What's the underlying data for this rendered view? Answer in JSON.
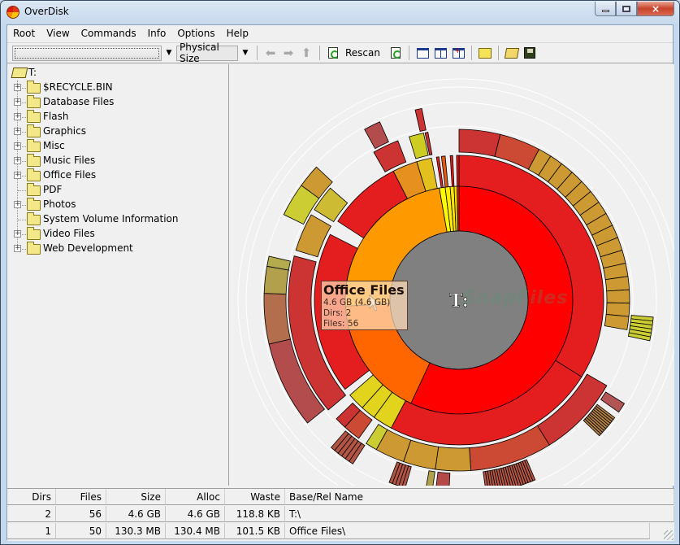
{
  "window": {
    "title": "OverDisk",
    "controls": {
      "minimize": "minimize",
      "maximize": "maximize",
      "close": "×"
    }
  },
  "menu": [
    "Root",
    "View",
    "Commands",
    "Info",
    "Options",
    "Help"
  ],
  "toolbar": {
    "path_value": "",
    "size_mode": "Physical Size",
    "rescan_label": "Rescan"
  },
  "tree": {
    "root": "T:",
    "items": [
      {
        "label": "$RECYCLE.BIN",
        "expandable": true
      },
      {
        "label": "Database Files",
        "expandable": true
      },
      {
        "label": "Flash",
        "expandable": true
      },
      {
        "label": "Graphics",
        "expandable": true
      },
      {
        "label": "Misc",
        "expandable": true
      },
      {
        "label": "Music Files",
        "expandable": true
      },
      {
        "label": "Office Files",
        "expandable": true
      },
      {
        "label": "PDF",
        "expandable": false
      },
      {
        "label": "Photos",
        "expandable": true
      },
      {
        "label": "System Volume Information",
        "expandable": false
      },
      {
        "label": "Video Files",
        "expandable": true
      },
      {
        "label": "Web Development",
        "expandable": true
      }
    ]
  },
  "chart": {
    "center_label": "T:",
    "watermark": "SnapFiles",
    "tooltip": {
      "title": "Office Files",
      "size": "4.6 GB (4.6 GB)",
      "dirs": "Dirs: 2",
      "files": "Files: 56"
    }
  },
  "chart_data": {
    "type": "sunburst",
    "title": "T:",
    "center_color": "#808080",
    "rings": [
      {
        "level": 1,
        "segments": [
          {
            "start": 0,
            "end": 205,
            "color": "#ff0000"
          },
          {
            "start": 205,
            "end": 267,
            "color": "#ff6600"
          },
          {
            "start": 267,
            "end": 350,
            "color": "#ff9900"
          },
          {
            "start": 350,
            "end": 353,
            "color": "#ffff00"
          },
          {
            "start": 353,
            "end": 355.5,
            "color": "#ffee00"
          },
          {
            "start": 355.5,
            "end": 357.5,
            "color": "#ffe400"
          },
          {
            "start": 357.5,
            "end": 359,
            "color": "#f0e000"
          },
          {
            "start": 359,
            "end": 360,
            "color": "#ff2a00"
          }
        ]
      },
      {
        "level": 2,
        "segments": [
          {
            "start": 0,
            "end": 122,
            "color": "#e41e1e"
          },
          {
            "start": 122,
            "end": 208,
            "color": "#e41e1e"
          },
          {
            "start": 208,
            "end": 216,
            "color": "#e2d31c"
          },
          {
            "start": 216,
            "end": 222,
            "color": "#e2d31c"
          },
          {
            "start": 222,
            "end": 229,
            "color": "#e2d31c"
          },
          {
            "start": 232,
            "end": 297,
            "color": "#e41e1e"
          },
          {
            "start": 303,
            "end": 333,
            "color": "#e41e1e"
          },
          {
            "start": 333,
            "end": 343,
            "color": "#e69020"
          },
          {
            "start": 343,
            "end": 349,
            "color": "#e4c01e"
          },
          {
            "start": 351,
            "end": 352,
            "color": "#e41e1e"
          },
          {
            "start": 353,
            "end": 354.5,
            "color": "#e05a14"
          },
          {
            "start": 356.5,
            "end": 357.5,
            "color": "#e41e1e"
          },
          {
            "start": 359,
            "end": 360,
            "color": "#e41e1e"
          }
        ]
      },
      {
        "level": 3,
        "segments": [
          {
            "start": 0,
            "end": 14,
            "color": "#cc3333"
          },
          {
            "start": 14,
            "end": 28,
            "color": "#cc4a33"
          },
          {
            "start": 28,
            "end": 100,
            "color": "#cc9933",
            "divisions": 16
          },
          {
            "start": 120,
            "end": 148,
            "color": "#cc3333"
          },
          {
            "start": 148,
            "end": 176,
            "color": "#cc4a33"
          },
          {
            "start": 176,
            "end": 188,
            "color": "#cc9933"
          },
          {
            "start": 188,
            "end": 199,
            "color": "#cc9933"
          },
          {
            "start": 199,
            "end": 209,
            "color": "#cc9933"
          },
          {
            "start": 209,
            "end": 213,
            "color": "#cccc33"
          },
          {
            "start": 216,
            "end": 222,
            "color": "#cc4a33"
          },
          {
            "start": 222,
            "end": 226,
            "color": "#cc3333"
          },
          {
            "start": 230,
            "end": 285,
            "color": "#cc3333"
          },
          {
            "start": 287,
            "end": 300,
            "color": "#cc9933"
          },
          {
            "start": 302,
            "end": 311,
            "color": "#ccbb33"
          },
          {
            "start": 330,
            "end": 339,
            "color": "#cc3333"
          },
          {
            "start": 343,
            "end": 348,
            "color": "#cccc22"
          },
          {
            "start": 348.5,
            "end": 349.5,
            "color": "#cc3333"
          }
        ]
      },
      {
        "level": 4,
        "segments": [
          {
            "start": 95,
            "end": 102,
            "color": "#cccc33",
            "divisions": 6
          },
          {
            "start": 122,
            "end": 125,
            "color": "#b35555"
          },
          {
            "start": 127,
            "end": 134,
            "color": "#b38044",
            "divisions": 10
          },
          {
            "start": 157,
            "end": 172,
            "color": "#b35544",
            "divisions": 20
          },
          {
            "start": 183,
            "end": 187,
            "color": "#b34a4a"
          },
          {
            "start": 188,
            "end": 190,
            "color": "#b3a04a"
          },
          {
            "start": 196,
            "end": 201,
            "color": "#b35544",
            "divisions": 5
          },
          {
            "start": 213,
            "end": 221,
            "color": "#b35544",
            "divisions": 6
          },
          {
            "start": 231,
            "end": 257,
            "color": "#b34d4d"
          },
          {
            "start": 257,
            "end": 272,
            "color": "#b36e4d"
          },
          {
            "start": 272,
            "end": 280,
            "color": "#b3a04d"
          },
          {
            "start": 280,
            "end": 283,
            "color": "#b3ab4d"
          },
          {
            "start": 296,
            "end": 306,
            "color": "#cccc33"
          },
          {
            "start": 306,
            "end": 313,
            "color": "#cc9933"
          },
          {
            "start": 331,
            "end": 336,
            "color": "#b34d4d"
          },
          {
            "start": 347,
            "end": 349,
            "color": "#cc3333"
          }
        ]
      }
    ]
  },
  "grid": {
    "columns": [
      "Dirs",
      "Files",
      "Size",
      "Alloc",
      "Waste",
      "Base/Rel Name"
    ],
    "rows": [
      [
        "2",
        "56",
        "4.6 GB",
        "4.6 GB",
        "118.8 KB",
        "T:\\"
      ],
      [
        "1",
        "50",
        "130.3 MB",
        "130.4 MB",
        "101.5 KB",
        "Office Files\\"
      ]
    ]
  }
}
